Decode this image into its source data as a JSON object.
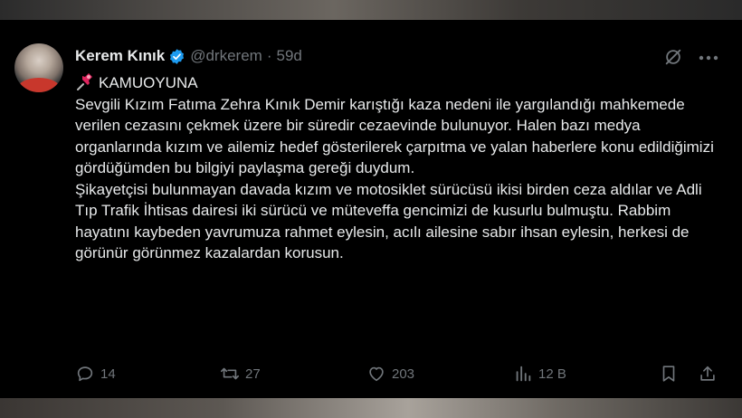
{
  "author": {
    "name": "Kerem Kınık",
    "handle": "@drkerem",
    "separator": "·",
    "time": "59d",
    "verified": true
  },
  "tweet": {
    "title": "KAMUOYUNA",
    "title_icon": "pushpin-icon",
    "paragraphs": [
      "Sevgili Kızım Fatıma Zehra Kınık Demir karıştığı kaza nedeni ile yargılandığı mahkemede verilen cezasını çekmek üzere bir süredir cezaevinde bulunuyor. Halen bazı medya organlarında kızım ve ailemiz hedef gösterilerek çarpıtma ve yalan haberlere konu edildiğimizi gördüğümden bu bilgiyi paylaşma gereği duydum.",
      "Şikayetçisi bulunmayan davada kızım ve motosiklet sürücüsü ikisi birden ceza aldılar ve Adli Tıp Trafik İhtisas dairesi iki sürücü ve müteveffa gencimizi de kusurlu bulmuştu. Rabbim hayatını kaybeden yavrumuza rahmet eylesin, acılı ailesine sabır ihsan eylesin, herkesi de görünür görünmez kazalardan korusun."
    ]
  },
  "actions": {
    "replies": "14",
    "retweets": "27",
    "likes": "203",
    "views": "12 B"
  },
  "colors": {
    "background": "#000000",
    "text": "#e7e9ea",
    "muted": "#71767b",
    "verified_badge": "#1d9bf0"
  }
}
